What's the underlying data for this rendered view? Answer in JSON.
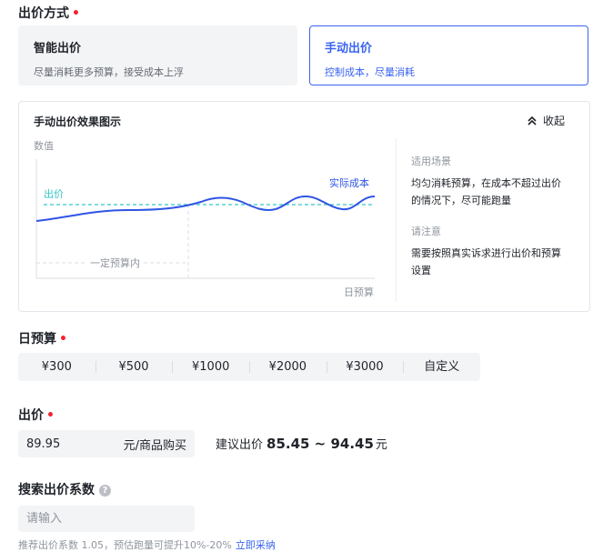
{
  "bid_method": {
    "title": "出价方式",
    "required_mark": "•",
    "options": [
      {
        "title": "智能出价",
        "desc": "尽量消耗更多预算，接受成本上浮"
      },
      {
        "title": "手动出价",
        "desc": "控制成本，尽量消耗"
      }
    ],
    "selected": "手动出价"
  },
  "effect_panel": {
    "title": "手动出价效果图示",
    "collapse_label": "收起",
    "chart_labels": {
      "ylabel": "数值",
      "bid_line": "出价",
      "actual_cost": "实际成本",
      "budget_area": "一定预算内",
      "xlabel": "日预算"
    },
    "scenario_heading": "适用场景",
    "scenario_text": "均匀消耗预算，在成本不超过出价的情况下，尽可能跑量",
    "note_heading": "请注意",
    "note_text": "需要按照真实诉求进行出价和预算设置"
  },
  "budget": {
    "title": "日预算",
    "required_mark": "•",
    "options": [
      "¥300",
      "¥500",
      "¥1000",
      "¥2000",
      "¥3000",
      "自定义"
    ]
  },
  "bid": {
    "title": "出价",
    "required_mark": "•",
    "value": "89.95",
    "unit": "元/商品购买",
    "suggest_prefix": "建议出价",
    "suggest_range": "85.45 ~ 94.45",
    "suggest_unit": "元"
  },
  "coefficient": {
    "title": "搜索出价系数",
    "help_icon": "?",
    "placeholder": "请输入",
    "hint": "推荐出价系数 1.05，预估跑量可提升10%-20%",
    "hint_link": "立即采纳"
  },
  "colors": {
    "accent": "#3a64f0",
    "bid_line": "#37c5c8",
    "required": "#f5222d"
  }
}
